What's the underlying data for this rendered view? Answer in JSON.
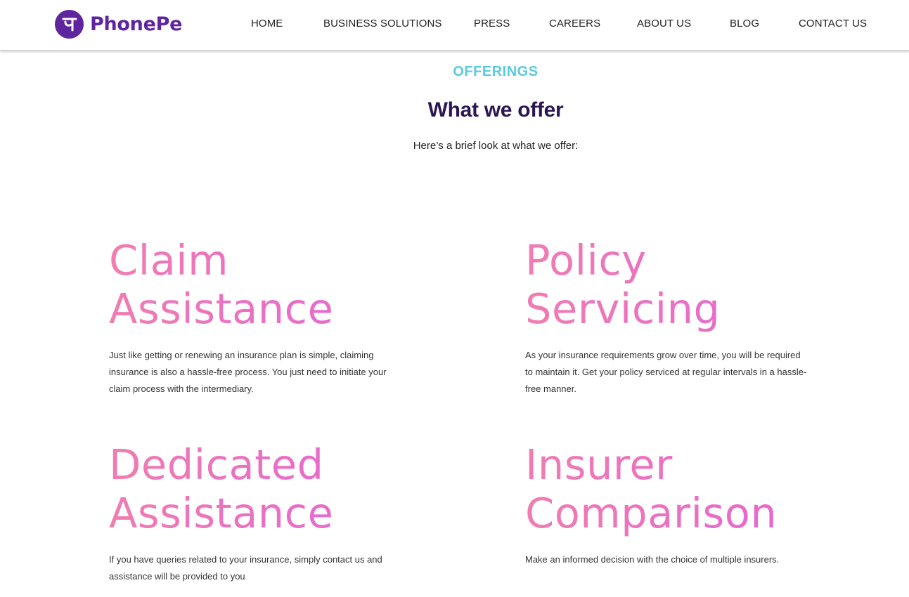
{
  "brand": {
    "name": "PhonePe",
    "logo_glyph": "पे",
    "color": "#5f259f"
  },
  "nav": {
    "items": [
      {
        "label": "HOME"
      },
      {
        "label": "BUSINESS SOLUTIONS"
      },
      {
        "label": "PRESS"
      },
      {
        "label": "CAREERS"
      },
      {
        "label": "ABOUT US"
      },
      {
        "label": "BLOG"
      },
      {
        "label": "CONTACT US"
      }
    ]
  },
  "section": {
    "eyebrow": "OFFERINGS",
    "title": "What we offer",
    "subtitle": "Here’s a brief look at what we offer:",
    "eyebrow_color": "#5bcbe0",
    "title_color": "#2b1653"
  },
  "offerings": [
    {
      "title_line1": "Claim",
      "title_line2": "Assistance",
      "description": "Just like getting or renewing an insurance plan is simple, claiming insurance is also a hassle-free process. You just need to initiate your claim process with the intermediary."
    },
    {
      "title_line1": "Policy",
      "title_line2": "Servicing",
      "description": "As your insurance requirements grow over time, you will be required to maintain it. Get your policy serviced at regular intervals in a hassle-free manner."
    },
    {
      "title_line1": "Dedicated",
      "title_line2": "Assistance",
      "description": "If you have queries related to your insurance, simply contact us and assistance will be provided to you"
    },
    {
      "title_line1": "Insurer",
      "title_line2": "Comparison",
      "description": "Make an informed decision with the choice of multiple insurers."
    }
  ],
  "colors": {
    "title_gradient_start": "#f07db0",
    "title_gradient_end": "#e564d6"
  }
}
